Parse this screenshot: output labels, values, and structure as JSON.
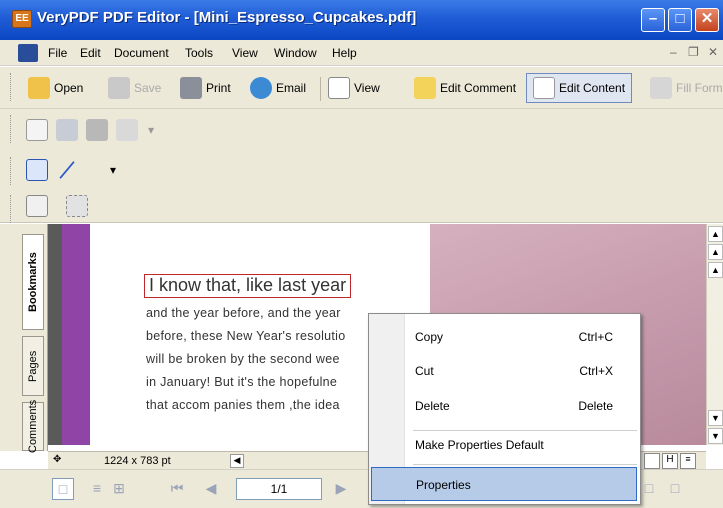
{
  "window": {
    "title": "VeryPDF PDF Editor - [Mini_Espresso_Cupcakes.pdf]",
    "app_icon_text": "EE"
  },
  "menubar": {
    "items": [
      "File",
      "Edit",
      "Document",
      "Tools",
      "View",
      "Window",
      "Help"
    ]
  },
  "toolbar1": {
    "open": "Open",
    "save": "Save",
    "print": "Print",
    "email": "Email",
    "view": "View",
    "edit_comment": "Edit Comment",
    "edit_content": "Edit Content",
    "fill_form": "Fill Form"
  },
  "document": {
    "heading": "I know that, like last year",
    "lines": [
      "and the year before, and the year",
      "before, these New Year's resolutio",
      "will be broken by the second wee",
      "in January! But it's the hopefulne",
      "that accom panies them ,the idea"
    ]
  },
  "left_tabs": [
    "Bookmarks",
    "Pages",
    "Comments"
  ],
  "status": {
    "page_size": "1224 x 783 pt"
  },
  "nav": {
    "page": "1/1"
  },
  "context_menu": {
    "items": [
      {
        "label": "Copy",
        "shortcut": "Ctrl+C"
      },
      {
        "label": "Cut",
        "shortcut": "Ctrl+X"
      },
      {
        "label": "Delete",
        "shortcut": "Delete"
      },
      {
        "label": "Make Properties Default",
        "shortcut": ""
      },
      {
        "label": "Properties",
        "shortcut": ""
      }
    ],
    "highlighted": "Properties"
  },
  "colors": {
    "titlebar": "#1f5cd6",
    "chrome": "#ece9d8",
    "selection_border": "#c0272d",
    "menu_highlight": "#b6cbe8",
    "sidebar_purple": "#8f44a6"
  }
}
